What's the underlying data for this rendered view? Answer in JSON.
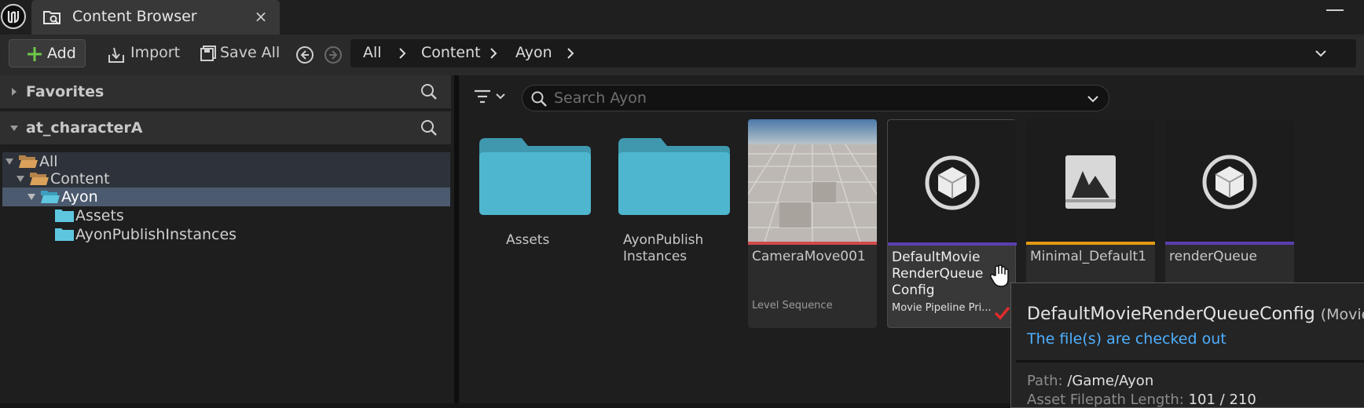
{
  "window": {
    "tab_title": "Content Browser",
    "tab_close": "×"
  },
  "toolbar": {
    "add_label": "Add",
    "import_label": "Import",
    "save_all_label": "Save All"
  },
  "breadcrumb": [
    "All",
    "Content",
    "Ayon"
  ],
  "sidebar": {
    "favorites_title": "Favorites",
    "project_title": "at_characterA",
    "tree": [
      {
        "label": "All",
        "depth": 0,
        "expanded": true
      },
      {
        "label": "Content",
        "depth": 1,
        "expanded": true
      },
      {
        "label": "Ayon",
        "depth": 2,
        "expanded": true,
        "selected": true
      },
      {
        "label": "Assets",
        "depth": 3
      },
      {
        "label": "AyonPublishInstances",
        "depth": 3
      }
    ]
  },
  "search": {
    "placeholder": "Search Ayon",
    "value": ""
  },
  "assets": {
    "folders": [
      {
        "name": "Assets"
      },
      {
        "name": "AyonPublish Instances"
      }
    ],
    "items": [
      {
        "name": "CameraMove001",
        "type": "Level Sequence",
        "bar_color": "#d14a4a",
        "icon": "level-sequence-thumbnail"
      },
      {
        "name": "DefaultMovie RenderQueue Config",
        "type": "Movie Pipeline Pri...",
        "bar_color": "#5b3fb0",
        "icon": "blueprint-class-icon"
      },
      {
        "name": "Minimal_Default1",
        "type": "",
        "bar_color": "#e39a14",
        "icon": "level-map-icon"
      },
      {
        "name": "renderQueue",
        "type": "",
        "bar_color": "#5b3fb0",
        "icon": "blueprint-class-icon"
      }
    ]
  },
  "tooltip": {
    "title": "DefaultMovieRenderQueueConfig",
    "type_suffix": "(Movie",
    "status": "The file(s) are checked out",
    "path_key": "Path:",
    "path_value": "/Game/Ayon",
    "length_key": "Asset Filepath Length:",
    "length_value": "101 / 210"
  },
  "colors": {
    "folder": "#4fb6cf",
    "tree_folder": "#d9a15a",
    "selection": "#4b5a6e",
    "accent_link": "#4fb0ff",
    "checkout": "#e02a2a"
  }
}
